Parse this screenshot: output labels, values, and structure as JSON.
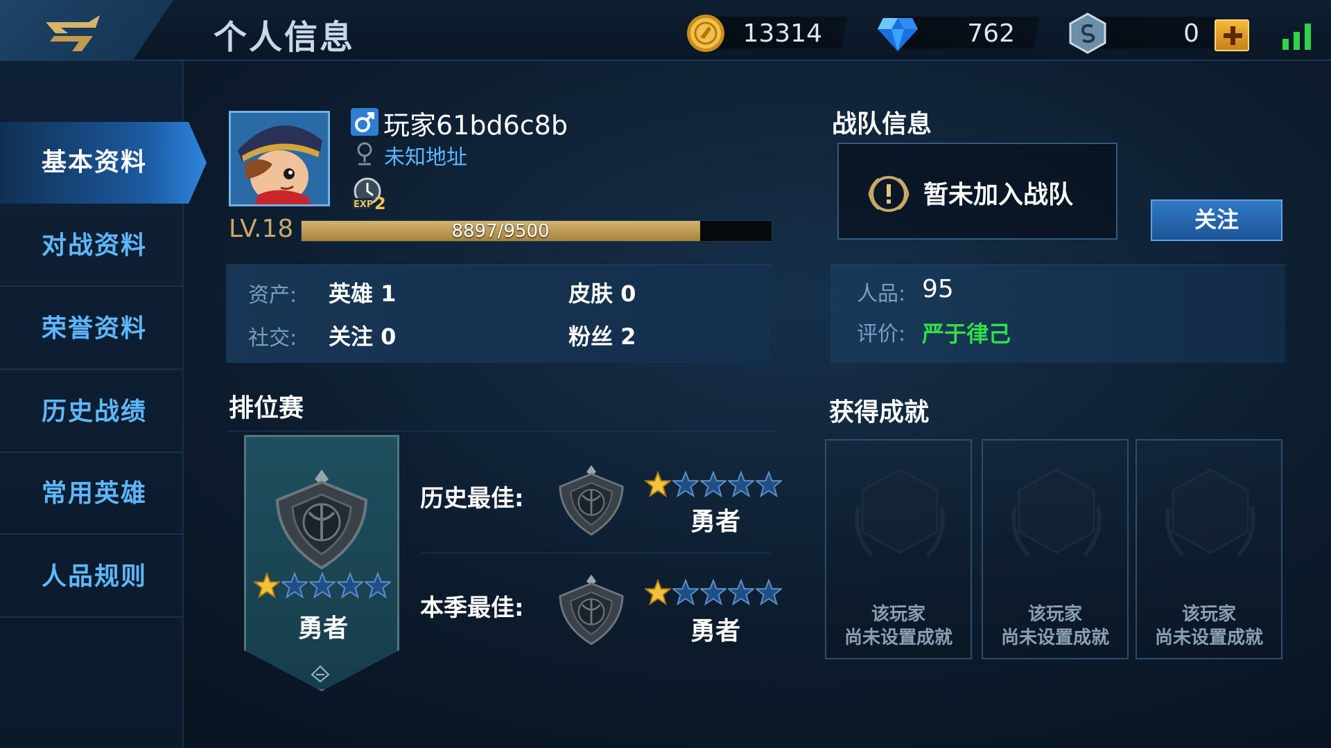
{
  "header": {
    "title": "个人信息",
    "back_icon": "back-arrow-icon",
    "currencies": [
      {
        "icon": "gold-coin-icon",
        "value": "13314"
      },
      {
        "icon": "diamond-icon",
        "value": "762"
      },
      {
        "icon": "voucher-icon",
        "value": "0"
      }
    ],
    "add_icon": "plus-icon",
    "signal_icon": "signal-strength-icon"
  },
  "sidebar": {
    "items": [
      {
        "label": "基本资料",
        "active": true
      },
      {
        "label": "对战资料",
        "active": false
      },
      {
        "label": "荣誉资料",
        "active": false
      },
      {
        "label": "历史战绩",
        "active": false
      },
      {
        "label": "常用英雄",
        "active": false
      },
      {
        "label": "人品规则",
        "active": false
      }
    ]
  },
  "profile": {
    "name": "玩家61bd6c8b",
    "gender_icon": "male-icon",
    "location": "未知地址",
    "exp_badge_icon": "exp-double-icon",
    "level": "LV.18",
    "xp_text": "8897/9500",
    "xp_fraction": 0.9366
  },
  "stats": {
    "assets_label": "资产:",
    "heroes": "英雄 1",
    "skins": "皮肤 0",
    "social_label": "社交:",
    "following": "关注 0",
    "fans": "粉丝 2"
  },
  "team": {
    "title": "战队信息",
    "status": "暂未加入战队",
    "follow_button": "关注"
  },
  "reputation": {
    "score_label": "人品:",
    "score": "95",
    "rating_label": "评价:",
    "rating": "严于律己",
    "rating_color": "#2fe04a"
  },
  "ranked": {
    "title": "排位赛",
    "current": {
      "rank": "勇者",
      "stars": 1,
      "max_stars": 5
    },
    "history_best_label": "历史最佳:",
    "history_best": {
      "rank": "勇者",
      "stars": 1,
      "max_stars": 5
    },
    "season_best_label": "本季最佳:",
    "season_best": {
      "rank": "勇者",
      "stars": 1,
      "max_stars": 5
    }
  },
  "achievements": {
    "title": "获得成就",
    "cards": [
      {
        "line1": "该玩家",
        "line2": "尚未设置成就"
      },
      {
        "line1": "该玩家",
        "line2": "尚未设置成就"
      },
      {
        "line1": "该玩家",
        "line2": "尚未设置成就"
      }
    ]
  },
  "colors": {
    "accent_blue": "#5fb7ff",
    "gold": "#c9a86a"
  }
}
